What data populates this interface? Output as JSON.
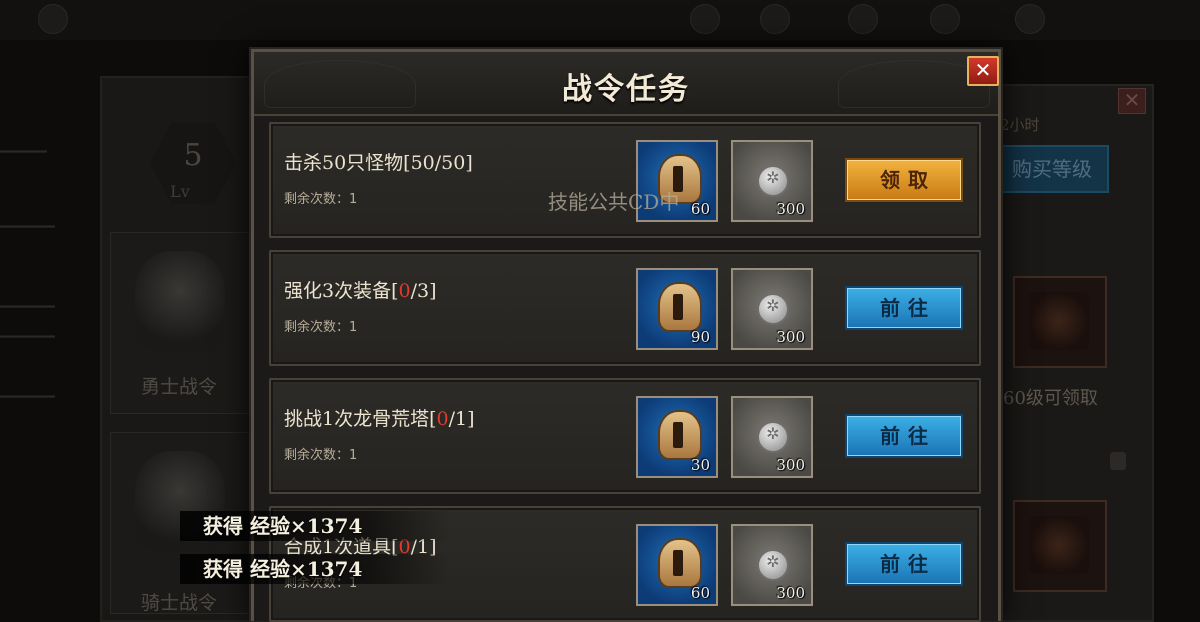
{
  "background": {
    "level_number": "5",
    "level_label": "Lv",
    "left_cards": [
      {
        "title": "勇士战令"
      },
      {
        "title": "骑士战令"
      }
    ],
    "buy_level_label": "购买等级",
    "remaining_hours": "2小时",
    "level_claim_text": "60级可领取"
  },
  "modal": {
    "title": "战令任务",
    "close_label": "✕"
  },
  "tasks": [
    {
      "name": "击杀50只怪物[",
      "progress_current": "50",
      "progress_total": "/50]",
      "remaining": "剩余次数：1",
      "reward_helmet_qty": "60",
      "reward_coin_qty": "300",
      "action": "领取"
    },
    {
      "name": "强化3次装备[",
      "progress_current": "0",
      "progress_total": "/3]",
      "remaining": "剩余次数：1",
      "reward_helmet_qty": "90",
      "reward_coin_qty": "300",
      "action": "前往"
    },
    {
      "name": "挑战1次龙骨荒塔[",
      "progress_current": "0",
      "progress_total": "/1]",
      "remaining": "剩余次数：1",
      "reward_helmet_qty": "30",
      "reward_coin_qty": "300",
      "action": "前往"
    },
    {
      "name": "合成1次道具[",
      "progress_current": "0",
      "progress_total": "/1]",
      "remaining": "剩余次数：1",
      "reward_helmet_qty": "60",
      "reward_coin_qty": "300",
      "action": "前往"
    }
  ],
  "cooldown_toast": "技能公共CD中",
  "notifications": [
    {
      "text": "获得 经验×1374"
    },
    {
      "text": "获得 经验×1374"
    }
  ],
  "colors": {
    "progress_incomplete": "#e33a2e",
    "claim_button": "#e09a2a",
    "go_button": "#2a93d2",
    "close_button": "#c2301f"
  }
}
